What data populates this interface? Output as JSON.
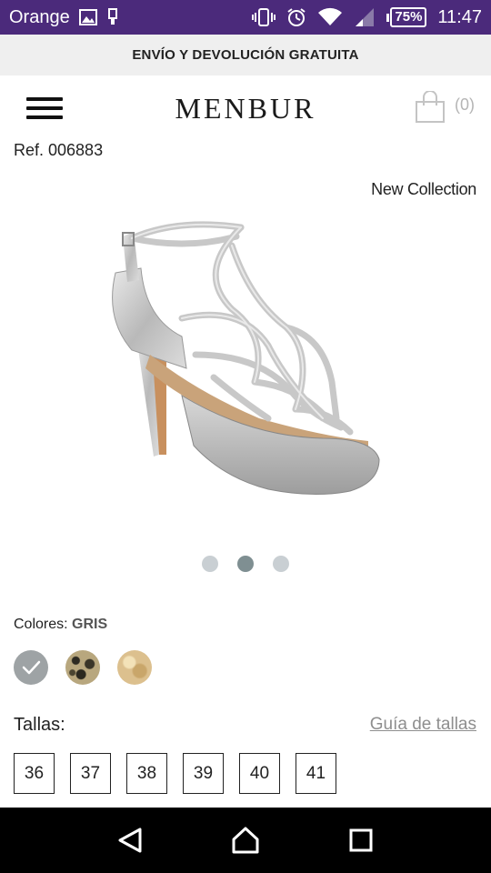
{
  "status_bar": {
    "carrier": "Orange",
    "battery": "75%",
    "time": "11:47"
  },
  "promo": {
    "text": "ENVÍO Y DEVOLUCIÓN GRATUITA"
  },
  "header": {
    "logo": "MENBUR",
    "cart_count": "(0)"
  },
  "product": {
    "ref": "Ref. 006883",
    "badge": "New Collection",
    "gallery": {
      "count": 3,
      "active_index": 1
    }
  },
  "colors": {
    "label": "Colores:",
    "selected": "GRIS",
    "swatches": [
      "gris",
      "leopardo",
      "oro"
    ]
  },
  "sizes": {
    "label": "Tallas:",
    "guide_link": "Guía de tallas",
    "options": [
      "36",
      "37",
      "38",
      "39",
      "40",
      "41"
    ]
  },
  "theme": {
    "status_bar_color": "#4b2a7b",
    "dot_active": "#7f8f92",
    "dot_inactive": "#c9cfd3"
  }
}
